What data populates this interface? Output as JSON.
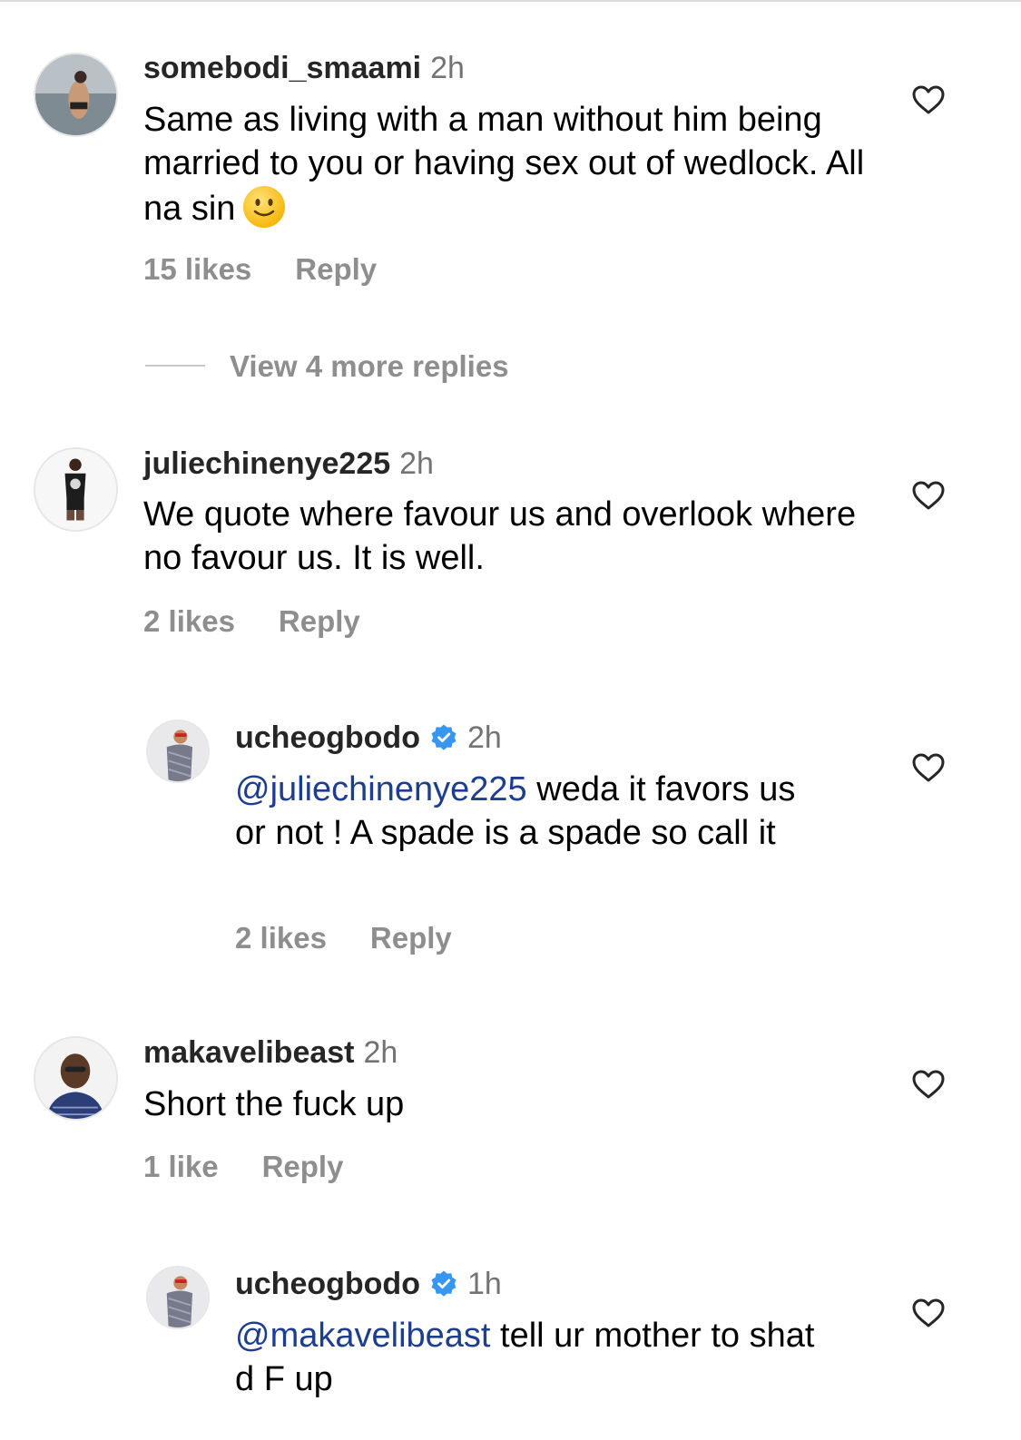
{
  "comments": [
    {
      "username": "somebodi_smaami",
      "time": "2h",
      "text": "Same as living with a man without him being married to you or having sex out of wedlock. All na sin",
      "emoji": "slightly-smiling-face",
      "likes": "15 likes",
      "reply": "Reply"
    },
    {
      "username": "juliechinenye225",
      "time": "2h",
      "text": "We quote where favour us and overlook where no favour us.  It is well.",
      "likes": "2 likes",
      "reply": "Reply"
    },
    {
      "username": "ucheogbodo",
      "time": "2h",
      "mention": "@juliechinenye225",
      "text": " weda it favors us or not ! A spade is a spade so call it",
      "likes": "2 likes",
      "reply": "Reply"
    },
    {
      "username": "makavelibeast",
      "time": "2h",
      "text": "Short the fuck up",
      "likes": "1 like",
      "reply": "Reply"
    },
    {
      "username": "ucheogbodo",
      "time": "1h",
      "mention": "@makavelibeast",
      "text": " tell ur mother to shat d F up"
    }
  ],
  "view_more_replies": "View 4 more replies",
  "icons": {
    "like": "heart-outline-icon",
    "verified": "verified-badge-icon"
  },
  "colors": {
    "mention": "#1d3d8f",
    "verified": "#3797f0",
    "secondary_text": "#8e8e8e"
  }
}
